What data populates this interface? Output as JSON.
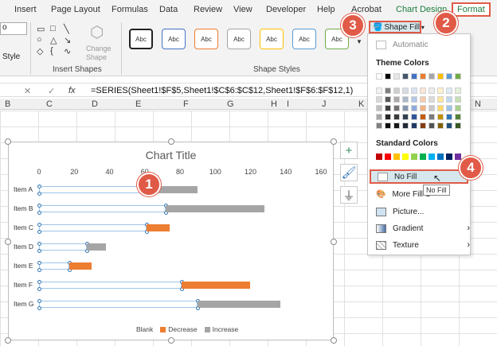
{
  "ribbon_tabs": [
    "Insert",
    "Page Layout",
    "Formulas",
    "Data",
    "Review",
    "View",
    "Developer",
    "Help",
    "Acrobat",
    "Chart Design",
    "Format"
  ],
  "ribbon": {
    "font_partial": "o",
    "style_partial": "Style",
    "insert_shapes_label": "Insert Shapes",
    "change_shape_line1": "Change",
    "change_shape_line2": "Shape",
    "shape_styles_label": "Shape Styles",
    "style_samples": [
      "Abc",
      "Abc",
      "Abc",
      "Abc",
      "Abc",
      "Abc",
      "Abc"
    ]
  },
  "formula_bar": {
    "fx_label": "fx",
    "formula": "=SERIES(Sheet1!$F$5,Sheet1!$C$6:$C$12,Sheet1!$F$6:$F$12,1)"
  },
  "columns": [
    "B",
    "C",
    "D",
    "E",
    "F",
    "G",
    "H",
    "I",
    "J",
    "K",
    "N"
  ],
  "shape_fill_button": "Shape Fill",
  "shape_fill_menu": {
    "automatic": "Automatic",
    "theme_colors_heading": "Theme Colors",
    "standard_colors_heading": "Standard Colors",
    "no_fill": "No Fill",
    "more_fill": "More Fill C",
    "picture": "Picture...",
    "gradient": "Gradient",
    "texture": "Texture",
    "tooltip": "No Fill"
  },
  "callouts": [
    "1",
    "2",
    "3",
    "4"
  ],
  "chart_data": {
    "type": "bar",
    "title": "Chart Title",
    "categories": [
      "Item A",
      "Item B",
      "Item C",
      "Item D",
      "Item E",
      "Item F",
      "Item G"
    ],
    "xlim": [
      0,
      160
    ],
    "xticks": [
      0,
      20,
      40,
      60,
      80,
      100,
      120,
      140,
      160
    ],
    "stacked": true,
    "series": [
      {
        "name": "Blank",
        "values": [
          62,
          72,
          61,
          27,
          17,
          81,
          90
        ]
      },
      {
        "name": "Decrease",
        "values": [
          0,
          0,
          13,
          0,
          13,
          39,
          0
        ]
      },
      {
        "name": "Increase",
        "values": [
          28,
          56,
          0,
          11,
          0,
          0,
          47
        ]
      }
    ],
    "colors": {
      "Blank": "#ffffff",
      "Decrease": "#ed7d31",
      "Increase": "#a5a5a5"
    },
    "legend_position": "bottom"
  }
}
